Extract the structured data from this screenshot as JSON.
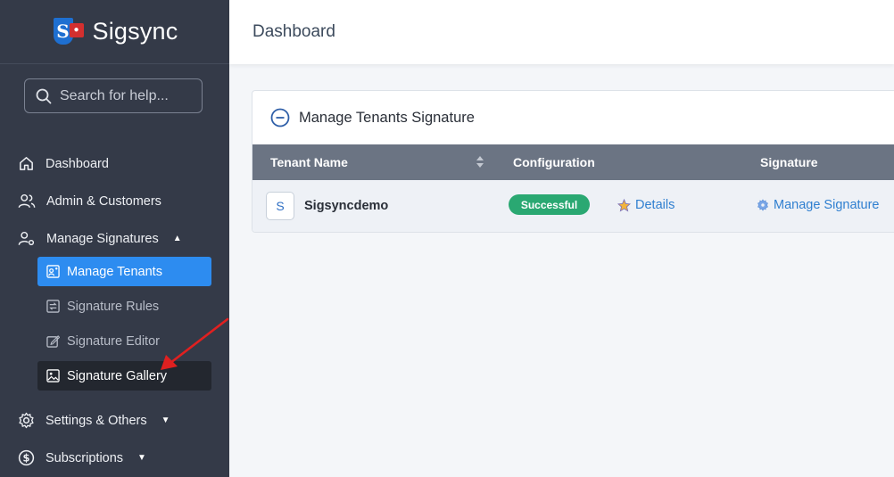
{
  "brand": {
    "name": "Sigsync",
    "logo_letter": "S"
  },
  "search": {
    "placeholder": "Search for help..."
  },
  "nav": {
    "dashboard": "Dashboard",
    "admin": "Admin & Customers",
    "manage_signatures": "Manage Signatures",
    "settings": "Settings & Others",
    "subscriptions": "Subscriptions"
  },
  "subnav": {
    "manage_tenants": "Manage Tenants",
    "signature_rules": "Signature Rules",
    "signature_editor": "Signature Editor",
    "signature_gallery": "Signature Gallery"
  },
  "header": {
    "title": "Dashboard"
  },
  "card": {
    "title": "Manage Tenants Signature",
    "columns": [
      "Tenant Name",
      "Configuration",
      "Signature"
    ],
    "rows": [
      {
        "avatar": "S",
        "name": "Sigsyncdemo",
        "status": "Successful",
        "details": "Details",
        "manage": "Manage Signature"
      }
    ]
  },
  "colors": {
    "sidebar": "#343a48",
    "active": "#2d8cf0",
    "success": "#2aa872",
    "link": "#2f7fd0",
    "table_head": "#6b7483"
  }
}
